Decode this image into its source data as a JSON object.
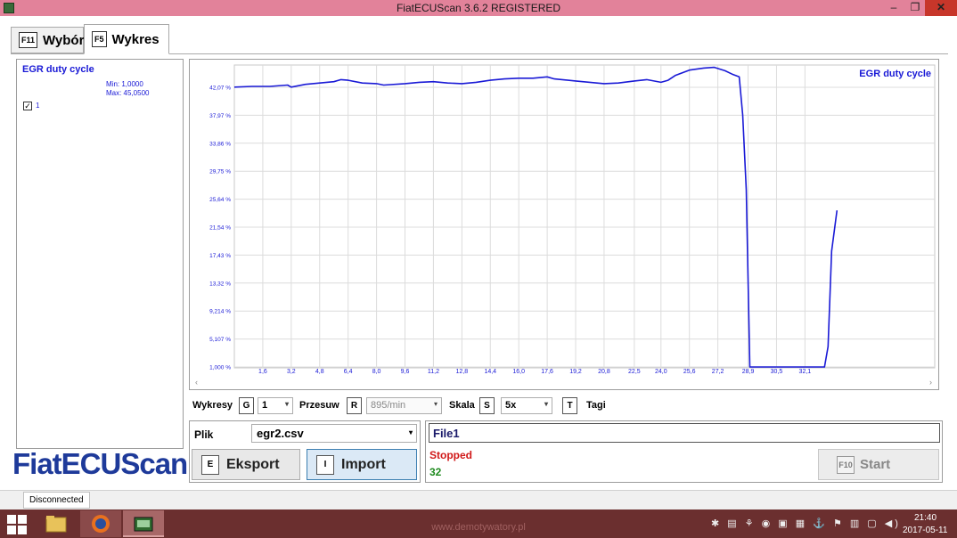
{
  "window": {
    "title": "FiatECUScan 3.6.2 REGISTERED",
    "minimize": "–",
    "maximize": "❐",
    "close": "✕"
  },
  "tabs": [
    {
      "key": "F11",
      "label": "Wybór",
      "active": false
    },
    {
      "key": "F5",
      "label": "Wykres",
      "active": true
    }
  ],
  "series_panel": {
    "name": "EGR duty cycle",
    "min": "Min: 1,0000",
    "max": "Max: 45,0500",
    "checkbox_label": "1",
    "checked": true
  },
  "logo": "FiatECUScan",
  "chart_data": {
    "type": "line",
    "legend": [
      "EGR duty cycle"
    ],
    "legend_position": "top-right",
    "grid": true,
    "color": "#1a1ad6",
    "y_tick_labels": [
      "1,000 %",
      "5,107 %",
      "9,214 %",
      "13,32 %",
      "17,43 %",
      "21,54 %",
      "25,64 %",
      "29,75 %",
      "33,86 %",
      "37,97 %",
      "42,07 %"
    ],
    "x_tick_labels": [
      "1,6",
      "3,2",
      "4,8",
      "6,4",
      "8,0",
      "9,6",
      "11,2",
      "12,8",
      "14,4",
      "16,0",
      "17,6",
      "19,2",
      "20,8",
      "22,5",
      "24,0",
      "25,6",
      "27,2",
      "28,9",
      "30,5",
      "32,1"
    ],
    "xlim": [
      0,
      39.4
    ],
    "ylim": [
      1.0,
      42.07
    ],
    "series": [
      {
        "values": [
          [
            0.0,
            42.1
          ],
          [
            1.0,
            42.2
          ],
          [
            2.0,
            42.2
          ],
          [
            3.0,
            42.4
          ],
          [
            3.2,
            42.1
          ],
          [
            4.0,
            42.5
          ],
          [
            4.8,
            42.7
          ],
          [
            5.6,
            42.9
          ],
          [
            6.0,
            43.2
          ],
          [
            6.4,
            43.1
          ],
          [
            7.2,
            42.7
          ],
          [
            8.0,
            42.6
          ],
          [
            8.4,
            42.4
          ],
          [
            9.6,
            42.6
          ],
          [
            10.4,
            42.8
          ],
          [
            11.2,
            42.9
          ],
          [
            12.0,
            42.7
          ],
          [
            12.8,
            42.6
          ],
          [
            13.6,
            42.8
          ],
          [
            14.4,
            43.1
          ],
          [
            15.2,
            43.3
          ],
          [
            16.0,
            43.4
          ],
          [
            16.8,
            43.4
          ],
          [
            17.6,
            43.6
          ],
          [
            18.0,
            43.3
          ],
          [
            19.2,
            43.0
          ],
          [
            20.0,
            42.8
          ],
          [
            20.8,
            42.6
          ],
          [
            21.6,
            42.7
          ],
          [
            22.5,
            43.0
          ],
          [
            23.2,
            43.2
          ],
          [
            24.0,
            42.8
          ],
          [
            24.4,
            43.1
          ],
          [
            24.8,
            43.8
          ],
          [
            25.6,
            44.6
          ],
          [
            26.4,
            44.9
          ],
          [
            27.0,
            45.0
          ],
          [
            27.6,
            44.5
          ],
          [
            28.0,
            44.0
          ],
          [
            28.4,
            43.6
          ],
          [
            28.6,
            38.0
          ],
          [
            28.8,
            27.0
          ],
          [
            29.0,
            1.0
          ],
          [
            33.2,
            1.0
          ],
          [
            33.4,
            4.0
          ],
          [
            33.6,
            18.0
          ],
          [
            33.9,
            24.0
          ]
        ]
      }
    ]
  },
  "controls": {
    "wykresy_label": "Wykresy",
    "wykresy_key": "G",
    "wykresy_value": "1",
    "przesuw_label": "Przesuw",
    "przesuw_key": "R",
    "przesuw_value": "895/min",
    "skala_label": "Skala",
    "skala_key": "S",
    "skala_value": "5x",
    "tagi_key": "T",
    "tagi_label": "Tagi"
  },
  "file_panel": {
    "plik_label": "Plik",
    "file_value": "egr2.csv",
    "eksport_key": "E",
    "eksport_label": "Eksport",
    "import_key": "I",
    "import_label": "Import"
  },
  "status_panel": {
    "file_name": "File1",
    "status": "Stopped",
    "count": "32",
    "start_key": "F10",
    "start_label": "Start"
  },
  "statusbar": {
    "connection": "Disconnected"
  },
  "taskbar": {
    "watermark": "www.demotywatory.pl",
    "tray_icons": "✱ ▤ ⚘ ◉ ▣ ▦ ⚓ ⚑ ▥ ▢ ◀)",
    "time": "21:40",
    "date": "2017-05-11"
  }
}
